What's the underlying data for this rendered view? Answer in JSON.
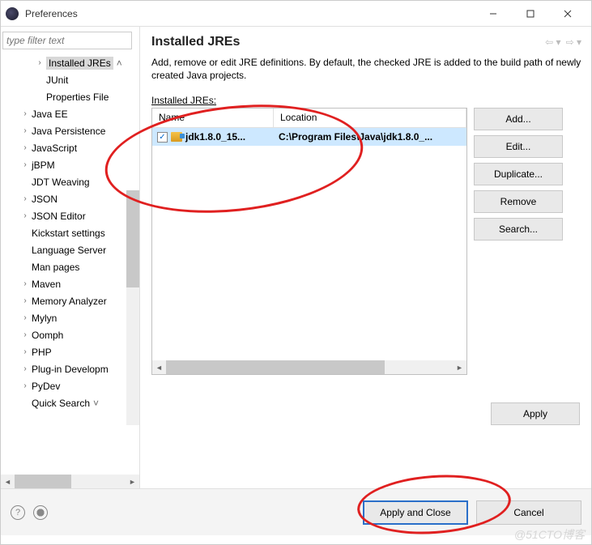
{
  "window": {
    "title": "Preferences"
  },
  "filter": {
    "placeholder": "type filter text"
  },
  "tree": [
    {
      "label": "Installed JREs",
      "level": 2,
      "exp": "›",
      "selected": true,
      "suffix": "˄"
    },
    {
      "label": "JUnit",
      "level": 2,
      "exp": ""
    },
    {
      "label": "Properties File",
      "level": 2,
      "exp": ""
    },
    {
      "label": "Java EE",
      "level": 1,
      "exp": "›"
    },
    {
      "label": "Java Persistence",
      "level": 1,
      "exp": "›"
    },
    {
      "label": "JavaScript",
      "level": 1,
      "exp": "›"
    },
    {
      "label": "jBPM",
      "level": 1,
      "exp": "›"
    },
    {
      "label": "JDT Weaving",
      "level": 1,
      "exp": ""
    },
    {
      "label": "JSON",
      "level": 1,
      "exp": "›"
    },
    {
      "label": "JSON Editor",
      "level": 1,
      "exp": "›"
    },
    {
      "label": "Kickstart settings",
      "level": 1,
      "exp": ""
    },
    {
      "label": "Language Server",
      "level": 1,
      "exp": ""
    },
    {
      "label": "Man pages",
      "level": 1,
      "exp": ""
    },
    {
      "label": "Maven",
      "level": 1,
      "exp": "›"
    },
    {
      "label": "Memory Analyzer",
      "level": 1,
      "exp": "›"
    },
    {
      "label": "Mylyn",
      "level": 1,
      "exp": "›"
    },
    {
      "label": "Oomph",
      "level": 1,
      "exp": "›"
    },
    {
      "label": "PHP",
      "level": 1,
      "exp": "›"
    },
    {
      "label": "Plug-in Developm",
      "level": 1,
      "exp": "›"
    },
    {
      "label": "PyDev",
      "level": 1,
      "exp": "›"
    },
    {
      "label": "Quick Search",
      "level": 1,
      "exp": "",
      "suffix": "˅"
    }
  ],
  "main": {
    "title": "Installed JREs",
    "description": "Add, remove or edit JRE definitions. By default, the checked JRE is added to the build path of newly created Java projects.",
    "section_label": "Installed JREs:",
    "table": {
      "headers": {
        "name": "Name",
        "location": "Location"
      },
      "rows": [
        {
          "checked": true,
          "name": "jdk1.8.0_15...",
          "location": "C:\\Program Files\\Java\\jdk1.8.0_..."
        }
      ]
    },
    "buttons": {
      "add": "Add...",
      "edit": "Edit...",
      "duplicate": "Duplicate...",
      "remove": "Remove",
      "search": "Search..."
    },
    "apply": "Apply"
  },
  "footer": {
    "apply_close": "Apply and Close",
    "cancel": "Cancel"
  },
  "watermark": "@51CTO博客"
}
